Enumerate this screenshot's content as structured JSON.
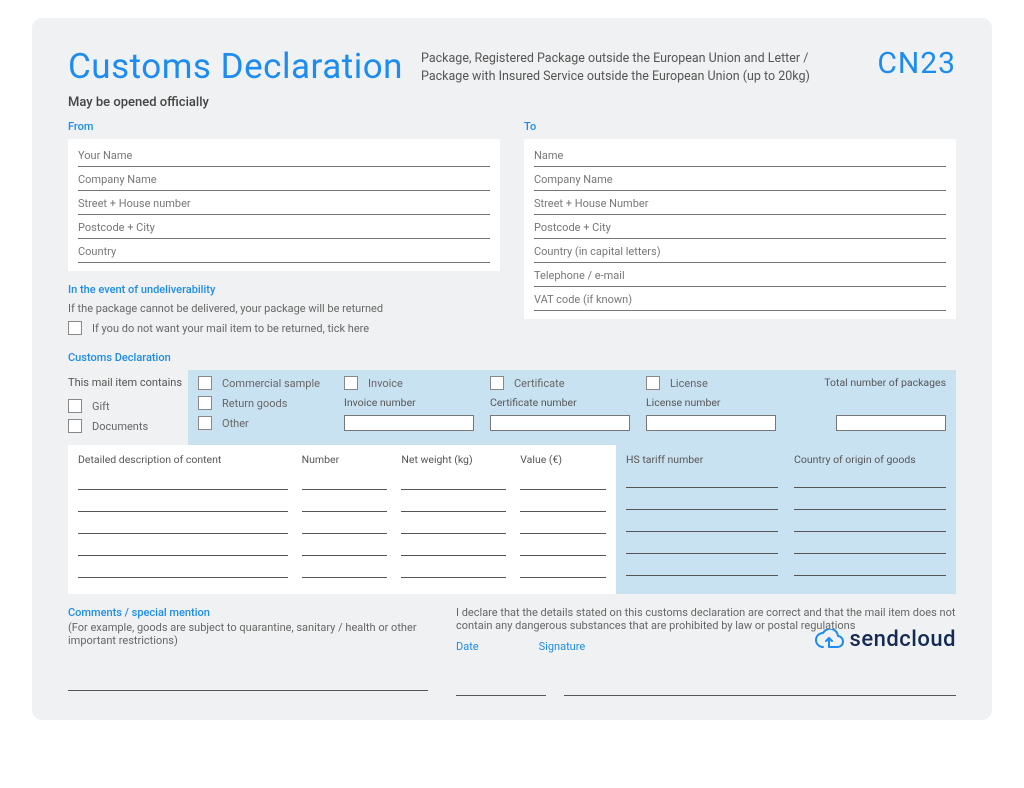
{
  "header": {
    "title": "Customs Declaration",
    "subtitle": "Package, Registered Package outside the European Union and Letter / Package with Insured Service outside the European Union (up to 20kg)",
    "code": "CN23",
    "opened": "May be opened officially"
  },
  "from": {
    "label": "From",
    "fields": [
      "Your Name",
      "Company Name",
      "Street + House number",
      "Postcode + City",
      "Country"
    ]
  },
  "to": {
    "label": "To",
    "fields": [
      "Name",
      "Company Name",
      "Street + House Number",
      "Postcode + City",
      "Country (in capital letters)",
      "Telephone / e-mail",
      "VAT code (if known)"
    ]
  },
  "undeliver": {
    "label": "In the event of undeliverability",
    "note": "If the package cannot be delivered, your package will be returned",
    "checkbox": "If you do not want your mail item to be returned, tick here"
  },
  "declaration": {
    "label": "Customs Declaration",
    "contains_heading": "This mail item contains",
    "left_checks": [
      "Gift",
      "Documents"
    ],
    "mid_checks": [
      "Commercial sample",
      "Return goods",
      "Other"
    ],
    "invoice_check": "Invoice",
    "invoice_number": "Invoice number",
    "certificate_check": "Certificate",
    "certificate_number": "Certificate number",
    "license_check": "License",
    "license_number": "License number",
    "total_packages": "Total number of packages"
  },
  "table": {
    "headers_left": [
      "Detailed description of content",
      "Number",
      "Net weight (kg)",
      "Value (€)"
    ],
    "headers_right": [
      "HS tariff number",
      "Country of origin of goods"
    ],
    "row_count": 5
  },
  "footer": {
    "comments_label": "Comments / special mention",
    "comments_note": "(For example, goods are subject to quarantine, sanitary / health or other important restrictions)",
    "declare_text": "I declare that the details stated on this customs declaration are correct and that the mail item does not contain any dangerous substances that are prohibited by law or postal regulations",
    "date_label": "Date",
    "signature_label": "Signature"
  },
  "brand": {
    "name": "sendcloud",
    "icon_color": "#1c8cf0",
    "text_color": "#152b56"
  }
}
